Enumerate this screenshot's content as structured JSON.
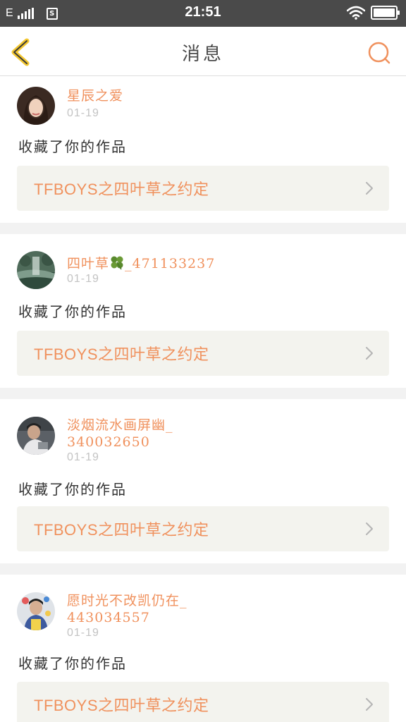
{
  "status_bar": {
    "carrier": "E",
    "sim_label": "S",
    "time": "21:51"
  },
  "header": {
    "title": "消息",
    "back_icon": "chevron-left-icon",
    "search_icon": "search-icon",
    "accent_color": "#f0915d"
  },
  "messages": [
    {
      "user": "星辰之爱",
      "has_clover": false,
      "date": "01-19",
      "action": "收藏了你的作品",
      "work_title": "TFBOYS之四叶草之约定"
    },
    {
      "user_prefix": "四叶草",
      "user_suffix": "_471133237",
      "has_clover": true,
      "date": "01-19",
      "action": "收藏了你的作品",
      "work_title": "TFBOYS之四叶草之约定"
    },
    {
      "user": "淡烟流水画屏幽_340032650",
      "has_clover": false,
      "date": "01-19",
      "action": "收藏了你的作品",
      "work_title": "TFBOYS之四叶草之约定"
    },
    {
      "user": "愿时光不改凯仍在_443034557",
      "has_clover": false,
      "date": "01-19",
      "action": "收藏了你的作品",
      "work_title": "TFBOYS之四叶草之约定"
    }
  ]
}
